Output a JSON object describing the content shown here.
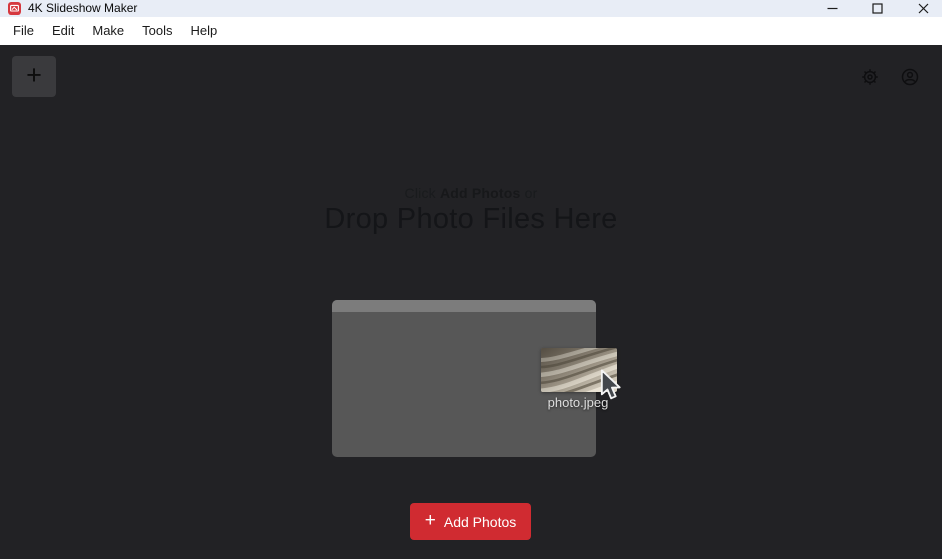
{
  "window": {
    "title": "4K Slideshow Maker"
  },
  "menu": {
    "items": [
      "File",
      "Edit",
      "Make",
      "Tools",
      "Help"
    ]
  },
  "toolbar": {
    "plus_glyph": "+"
  },
  "empty_state": {
    "hint_prefix": "Click",
    "hint_bold": "Add Photos",
    "hint_suffix": "or",
    "headline": "Drop Photo Files Here",
    "dragged_file_name": "photo.jpeg"
  },
  "footer": {
    "plus_glyph": "+",
    "add_photos_label": "Add Photos"
  },
  "icons": {
    "app_logo": "red rounded square with white photo glyph",
    "titlebar_controls": [
      "minimize-icon",
      "maximize-icon",
      "close-icon"
    ],
    "settings": "gear-icon",
    "account": "user-icon",
    "drag_pointer": "arrow-cursor-icon",
    "thumbnail_content": "beige rippled sand-wave photo"
  },
  "colors": {
    "accent_red": "#d02b31",
    "content_background": "#222225",
    "titlebar_background": "#e8edf6",
    "menubar_background": "#ffffff",
    "card_body": "#575757",
    "card_header": "#7c7c7c",
    "tile_background": "#3a3a3d"
  }
}
